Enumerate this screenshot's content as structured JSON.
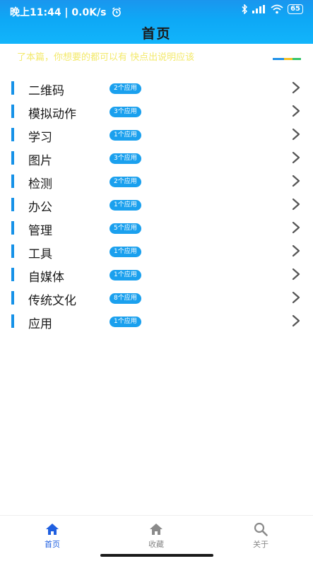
{
  "status_bar": {
    "left_text": "晚上11:44 | 0.0K/s",
    "battery": "65"
  },
  "header": {
    "title": "首页"
  },
  "notice": "了本篇，你想要的都可以有 快点出说明应该",
  "categories": [
    {
      "label": "二维码",
      "badge": "2个应用"
    },
    {
      "label": "模拟动作",
      "badge": "3个应用"
    },
    {
      "label": "学习",
      "badge": "1个应用"
    },
    {
      "label": "图片",
      "badge": "3个应用"
    },
    {
      "label": "检测",
      "badge": "2个应用"
    },
    {
      "label": "办公",
      "badge": "1个应用"
    },
    {
      "label": "管理",
      "badge": "5个应用"
    },
    {
      "label": "工具",
      "badge": "1个应用"
    },
    {
      "label": "自媒体",
      "badge": "1个应用"
    },
    {
      "label": "传统文化",
      "badge": "8个应用"
    },
    {
      "label": "应用",
      "badge": "1个应用"
    }
  ],
  "bottom_nav": {
    "home": "首页",
    "favorites": "收藏",
    "about": "关于"
  },
  "colors": {
    "accent": "#1692e8",
    "badge": "#1aa0ee",
    "nav_active": "#1f5fe0"
  },
  "icons": {
    "home": "home-icon",
    "favorites": "home-icon",
    "about": "search-icon",
    "row_arrow": "chevron-right-icon"
  }
}
